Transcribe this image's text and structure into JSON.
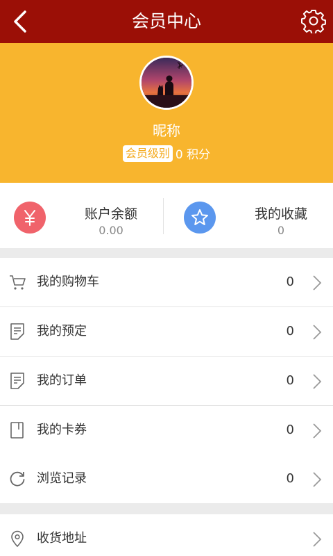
{
  "header": {
    "title": "会员中心",
    "back_icon": "chevron-left-icon",
    "settings_icon": "gear-icon"
  },
  "profile": {
    "nickname": "昵称",
    "level_badge": "会员级别",
    "points": "0 积分"
  },
  "stats": {
    "balance": {
      "label": "账户余额",
      "value": "0.00",
      "icon_glyph": "¥",
      "icon": "yen-icon",
      "color": "#f0636b"
    },
    "favorites": {
      "label": "我的收藏",
      "value": "0",
      "icon": "star-icon",
      "color": "#5b97ee"
    }
  },
  "menu": [
    {
      "icon": "cart-icon",
      "label": "我的购物车",
      "count": "0"
    },
    {
      "icon": "reservation-icon",
      "label": "我的预定",
      "count": "0"
    },
    {
      "icon": "order-icon",
      "label": "我的订单",
      "count": "0"
    },
    {
      "icon": "coupon-icon",
      "label": "我的卡券",
      "count": "0"
    },
    {
      "icon": "history-icon",
      "label": "浏览记录",
      "count": "0"
    }
  ],
  "menu2": [
    {
      "icon": "location-icon",
      "label": "收货地址"
    }
  ],
  "colors": {
    "header": "#9b0f06",
    "profile_bg": "#f8b52e",
    "gap": "#ebebeb"
  }
}
